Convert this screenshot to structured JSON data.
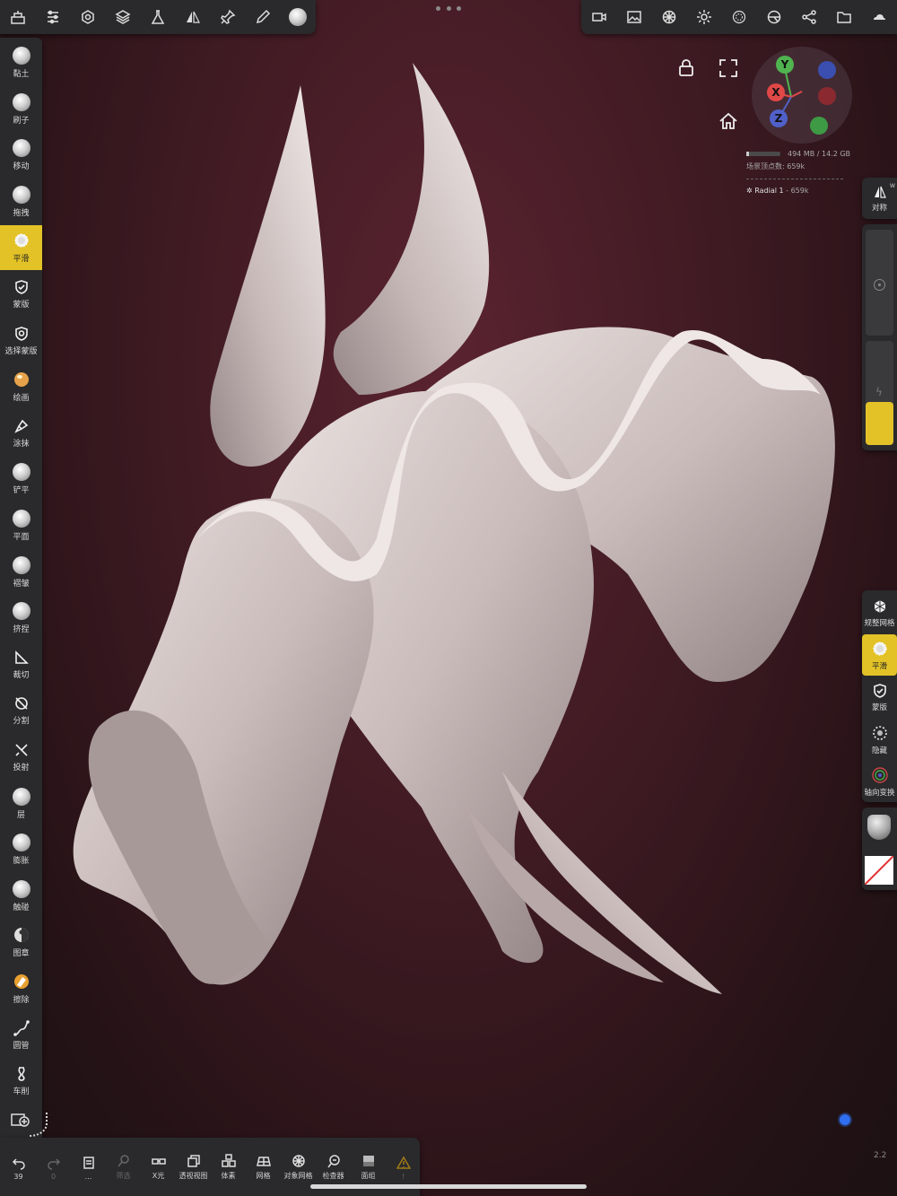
{
  "top_bar": {
    "left_icons": [
      "scene-tree-icon",
      "sliders-icon",
      "settings-gear-icon",
      "layers-icon",
      "flask-icon",
      "symmetry-icon",
      "pin-icon",
      "pen-icon",
      "brush-preview-icon"
    ],
    "right_icons": [
      "camera-icon",
      "image-icon",
      "shading-icon",
      "sun-icon",
      "material-sphere-icon",
      "topology-icon",
      "share-icon",
      "folder-icon",
      "cloud-icon"
    ]
  },
  "left_tools": [
    {
      "label": "黏土",
      "icon": "clay-ball-icon"
    },
    {
      "label": "刷子",
      "icon": "brush-ball-icon"
    },
    {
      "label": "移动",
      "icon": "move-ball-icon"
    },
    {
      "label": "拖拽",
      "icon": "drag-ball-icon"
    },
    {
      "label": "平滑",
      "icon": "smooth-icon",
      "active": true
    },
    {
      "label": "蒙版",
      "icon": "mask-shield-icon"
    },
    {
      "label": "选择蒙版",
      "icon": "select-mask-shield-icon"
    },
    {
      "label": "绘画",
      "icon": "paint-ball-icon"
    },
    {
      "label": "涂抹",
      "icon": "smudge-icon"
    },
    {
      "label": "铲平",
      "icon": "flatten-ball-icon"
    },
    {
      "label": "平面",
      "icon": "plane-ball-icon"
    },
    {
      "label": "褶皱",
      "icon": "crease-ball-icon"
    },
    {
      "label": "挤捏",
      "icon": "pinch-ball-icon"
    },
    {
      "label": "裁切",
      "icon": "trim-icon"
    },
    {
      "label": "分割",
      "icon": "split-icon"
    },
    {
      "label": "投射",
      "icon": "project-icon"
    },
    {
      "label": "层",
      "icon": "layer-ball-icon"
    },
    {
      "label": "膨胀",
      "icon": "inflate-ball-icon"
    },
    {
      "label": "触碰",
      "icon": "tube-ball-icon"
    },
    {
      "label": "图章",
      "icon": "stamp-icon"
    },
    {
      "label": "擦除",
      "icon": "eraser-icon"
    },
    {
      "label": "圆管",
      "icon": "tube-curve-icon"
    },
    {
      "label": "车削",
      "icon": "lathe-icon"
    }
  ],
  "bottom_bar": [
    {
      "label": "39",
      "icon": "undo-icon",
      "dim": false
    },
    {
      "label": "0",
      "icon": "redo-icon",
      "dim": true
    },
    {
      "label": "...",
      "icon": "history-icon",
      "dim": false
    },
    {
      "label": "筛选",
      "icon": "filter-search-icon",
      "dim": true
    },
    {
      "label": "X光",
      "icon": "xray-glasses-icon",
      "dim": false
    },
    {
      "label": "透视视图",
      "icon": "perspective-cube-icon",
      "dim": false
    },
    {
      "label": "体素",
      "icon": "voxel-icon",
      "dim": false
    },
    {
      "label": "网格",
      "icon": "grid-icon",
      "dim": false
    },
    {
      "label": "对象网格",
      "icon": "object-grid-icon",
      "dim": false
    },
    {
      "label": "检查器",
      "icon": "inspector-icon",
      "dim": false
    },
    {
      "label": "面组",
      "icon": "facegroup-icon",
      "dim": false
    },
    {
      "label": "!",
      "icon": "warning-icon",
      "dim": true
    }
  ],
  "viewport": {
    "gizmo_axes": {
      "y": "Y",
      "x": "X",
      "z": "Z"
    },
    "memory": "494 MB / 14.2 GB",
    "vertices": "场景顶点数:  659k",
    "object_name": "Radial 1",
    "object_vertices": " - 659k",
    "corner_value": "2.2"
  },
  "right_panel": {
    "symmetry": {
      "label": "对称",
      "badge": "W"
    },
    "tools": [
      {
        "label": "规整网格",
        "icon": "remesh-icon"
      },
      {
        "label": "平滑",
        "icon": "smooth-icon",
        "active": true
      },
      {
        "label": "蒙版",
        "icon": "mask-shield-icon"
      },
      {
        "label": "隐藏",
        "icon": "hide-icon"
      },
      {
        "label": "轴向变换",
        "icon": "gizmo-transform-icon"
      }
    ]
  },
  "colors": {
    "accent": "#e2c227",
    "panel": "#2a2a2c",
    "background": "#3e1a22",
    "axis_x": "#e04848",
    "axis_y": "#4fb44f",
    "axis_z": "#5060c8"
  }
}
